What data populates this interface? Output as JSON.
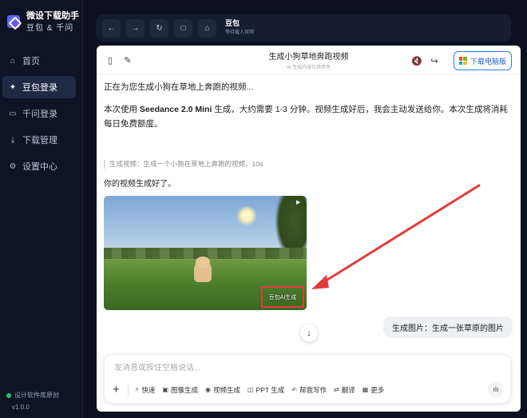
{
  "sidebar": {
    "brand_title": "微设下载助手",
    "brand_subtitle": "豆包 & 千问",
    "items": [
      {
        "label": "首页",
        "icon": "home-icon"
      },
      {
        "label": "豆包登录",
        "icon": "sparkle-icon",
        "active": true
      },
      {
        "label": "千问登录",
        "icon": "monitor-icon"
      },
      {
        "label": "下载管理",
        "icon": "download-icon"
      },
      {
        "label": "设置中心",
        "icon": "gear-icon"
      }
    ],
    "footer_badge": "设计软件库原创",
    "version": "v1.0.0"
  },
  "topbar": {
    "buttons": [
      "back-icon",
      "forward-icon",
      "refresh-icon",
      "stop-icon",
      "home-icon"
    ],
    "tab_title": "豆包",
    "tab_subtitle": "等待载入官网"
  },
  "chat": {
    "title": "生成小狗草地奔跑视频",
    "subtitle": "AI 生成内容仅供参考",
    "download_label": "下载电脑版",
    "msg_generating": "正在为您生成小狗在草地上奔跑的视频...",
    "msg_info_prefix": "本次使用 ",
    "msg_info_model": "Seedance 2.0 Mini",
    "msg_info_suffix": " 生成，大约需要 1-3 分钟。视频生成好后，我会主动发送给你。本次生成将消耗每日免费额度。",
    "quote": "生成视频：生成一个小狗在草地上奔跑的视频，10s",
    "msg_done": "你的视频生成好了。",
    "watermark": "豆包AI生成",
    "user_message": "生成图片：生成一张草原的图片"
  },
  "input": {
    "placeholder": "发消息或按住空格说话...",
    "tools": [
      {
        "label": "快速",
        "icon": "bolt-icon"
      },
      {
        "label": "图像生成",
        "icon": "image-icon"
      },
      {
        "label": "视频生成",
        "icon": "video-icon"
      },
      {
        "label": "PPT 生成",
        "icon": "ppt-icon"
      },
      {
        "label": "帮我写作",
        "icon": "write-icon"
      },
      {
        "label": "翻译",
        "icon": "translate-icon"
      },
      {
        "label": "更多",
        "icon": "grid-icon"
      }
    ]
  },
  "colors": {
    "accent": "#2f7cf6",
    "sidebar_bg": "#0d1424",
    "annotation": "#e23b3b"
  }
}
